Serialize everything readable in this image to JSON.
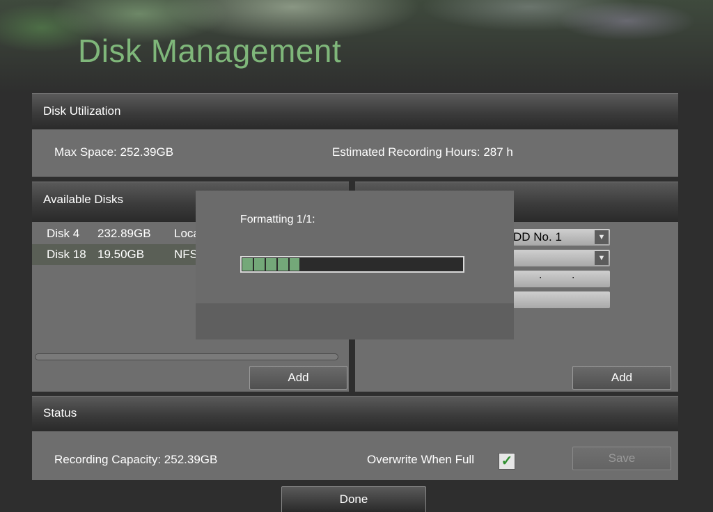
{
  "page": {
    "title": "Disk Management"
  },
  "utilization": {
    "header": "Disk Utilization",
    "max_space": "Max Space: 252.39GB",
    "estimated_hours": "Estimated Recording Hours: 287 h"
  },
  "available_disks": {
    "header": "Available Disks",
    "rows": [
      {
        "name": "Disk 4",
        "size": "232.89GB",
        "type": "Loca",
        "selected": false
      },
      {
        "name": "Disk 18",
        "size": "19.50GB",
        "type": "NFS",
        "selected": true
      }
    ],
    "add_label": "Add"
  },
  "right_panel": {
    "select_1_value": "DD No. 1",
    "select_2_value": "",
    "add_label": "Add"
  },
  "status": {
    "header": "Status",
    "recording_capacity": "Recording Capacity: 252.39GB",
    "overwrite_label": "Overwrite When Full",
    "overwrite_checked": true,
    "save_label": "Save"
  },
  "dialog": {
    "label": "Formatting 1/1:",
    "progress_fraction": 0.26
  },
  "footer": {
    "done_label": "Done"
  },
  "colors": {
    "title": "#7fb77a",
    "progress": "#74a879",
    "check": "#2f8f2f"
  }
}
